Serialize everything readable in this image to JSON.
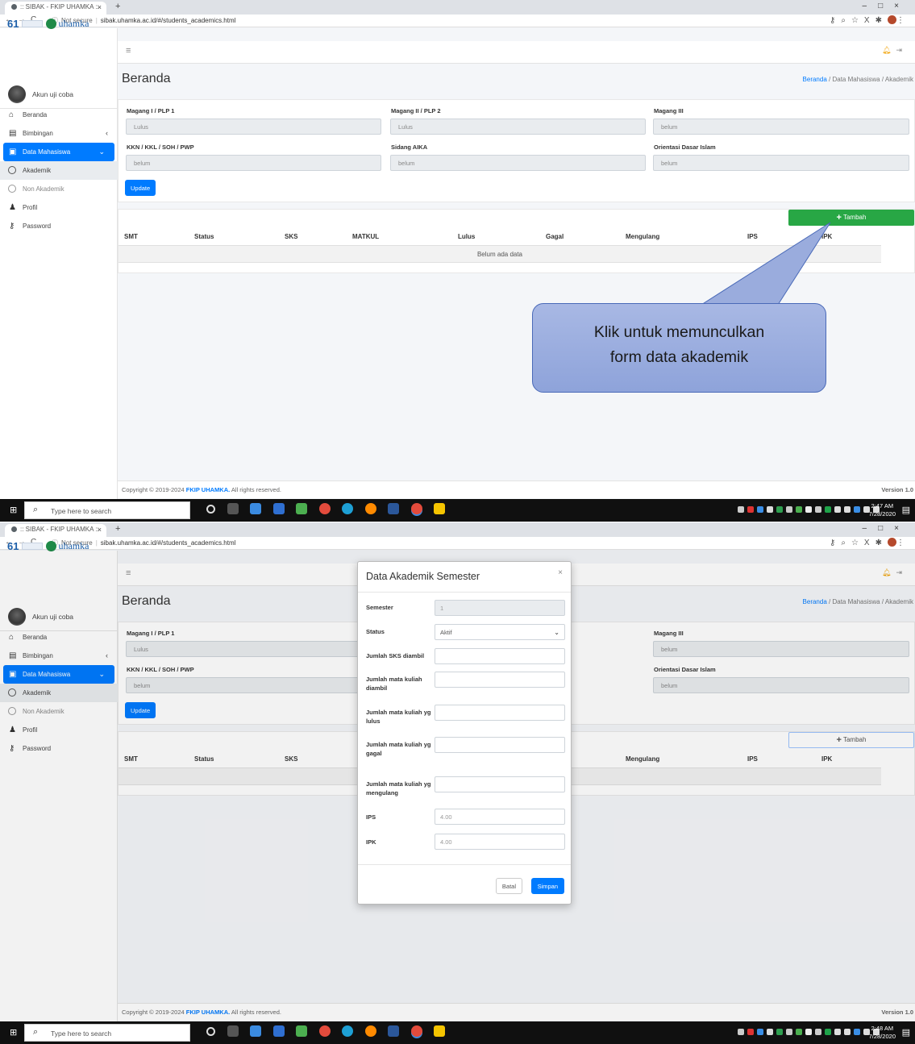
{
  "browser": {
    "tab_title": ":: SIBAK - FKIP UHAMKA ::",
    "not_secure": "Not secure",
    "url": "sibak.uhamka.ac.id/#/students_academics.html"
  },
  "app": {
    "logo_text": "uhamka",
    "logo_number": "61",
    "user_name": "Akun uji coba"
  },
  "sidebar": {
    "items": [
      {
        "label": "Beranda"
      },
      {
        "label": "Bimbingan"
      },
      {
        "label": "Data Mahasiswa"
      },
      {
        "label": "Akademik"
      },
      {
        "label": "Non Akademik"
      },
      {
        "label": "Profil"
      },
      {
        "label": "Password"
      }
    ]
  },
  "page": {
    "title": "Beranda",
    "breadcrumb_1": "Beranda",
    "breadcrumb_sep": "/",
    "breadcrumb_2": "Data Mahasiswa",
    "breadcrumb_3": "Akademik"
  },
  "status_fields": [
    {
      "label": "Magang I / PLP 1",
      "value": "Lulus"
    },
    {
      "label": "Magang II / PLP 2",
      "value": "Lulus"
    },
    {
      "label": "Magang III",
      "value": "belum"
    },
    {
      "label": "KKN / KKL / SOH / PWP",
      "value": "belum"
    },
    {
      "label": "Sidang AIKA",
      "value": "belum"
    },
    {
      "label": "Orientasi Dasar Islam",
      "value": "belum"
    }
  ],
  "buttons": {
    "update": "Update",
    "tambah": "Tambah"
  },
  "table": {
    "headers": [
      "SMT",
      "Status",
      "SKS",
      "MATKUL",
      "Lulus",
      "Gagal",
      "Mengulang",
      "IPS",
      "IPK"
    ],
    "empty_text": "Belum ada data"
  },
  "callout": {
    "text": "Klik untuk memunculkan\nform data akademik"
  },
  "footer": {
    "copyright_prefix": "Copyright © 2019-2024 ",
    "copyright_brand": "FKIP UHAMKA.",
    "copyright_suffix": " All rights reserved.",
    "version": "Version 1.0"
  },
  "taskbar": {
    "search_placeholder": "Type here to search",
    "time_1": "2:47 AM",
    "date_1": "7/28/2020",
    "time_2": "2:48 AM",
    "date_2": "7/28/2020"
  },
  "modal": {
    "title": "Data Akademik Semester",
    "fields": [
      {
        "label": "Semester",
        "value": "1"
      },
      {
        "label": "Status",
        "value": "Aktif"
      },
      {
        "label": "Jumlah SKS diambil",
        "value": ""
      },
      {
        "label": "Jumlah mata kuliah diambil",
        "value": ""
      },
      {
        "label": "Jumlah mata kuliah yg lulus",
        "value": ""
      },
      {
        "label": "Jumlah mata kuliah yg gagal",
        "value": ""
      },
      {
        "label": "Jumlah mata kuliah yg mengulang",
        "value": ""
      },
      {
        "label": "IPS",
        "value": "4.00"
      },
      {
        "label": "IPK",
        "value": "4.00"
      }
    ],
    "cancel": "Batal",
    "save": "Simpan"
  },
  "colors": {
    "primary": "#007bff",
    "success": "#28a745",
    "callout_fill": "#a8b8e4",
    "callout_border": "#4a6ab8"
  }
}
